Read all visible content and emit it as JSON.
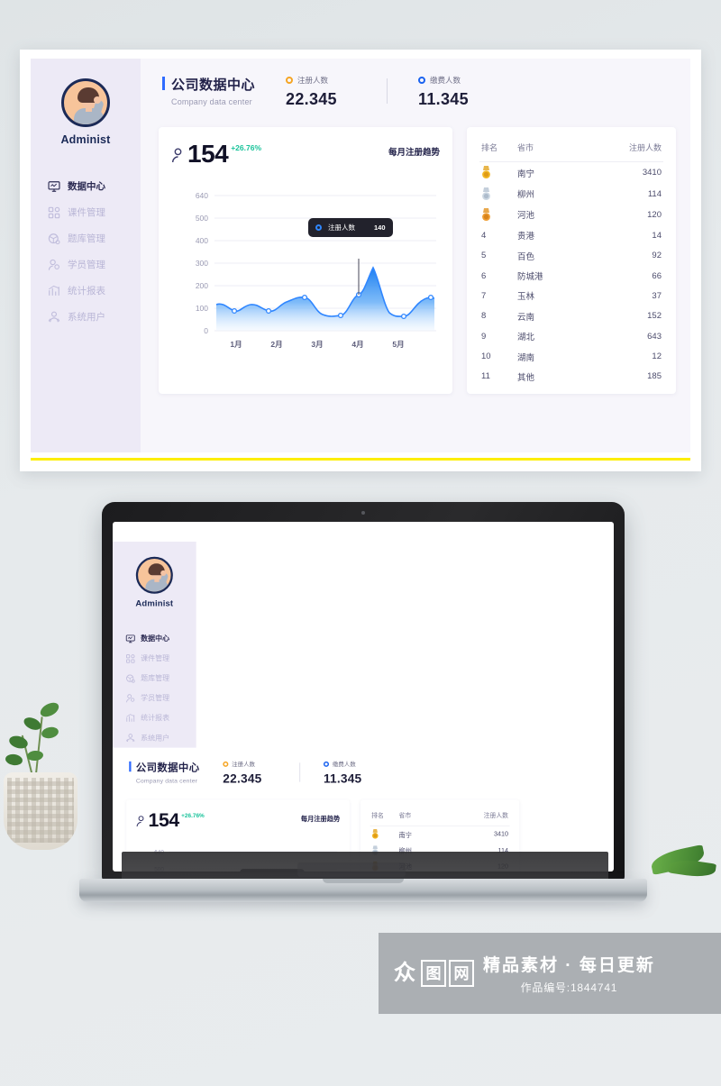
{
  "scene": {
    "background_color": "#e4e8ea",
    "laptop_label": "laptop-mockup"
  },
  "dashboard": {
    "sidebar": {
      "avatar_name": "Administ",
      "items": [
        {
          "label": "数据中心",
          "icon": "monitor-icon",
          "active": true
        },
        {
          "label": "课件管理",
          "icon": "grid-icon",
          "active": false
        },
        {
          "label": "题库管理",
          "icon": "box-icon",
          "active": false
        },
        {
          "label": "学员管理",
          "icon": "user-icon",
          "active": false
        },
        {
          "label": "统计报表",
          "icon": "chart-icon",
          "active": false
        },
        {
          "label": "系统用户",
          "icon": "users-icon",
          "active": false
        }
      ]
    },
    "header": {
      "title_cn": "公司数据中心",
      "title_en": "Company data center",
      "stats": [
        {
          "label": "注册人数",
          "value": "22.345",
          "color": "#f5a524"
        },
        {
          "label": "缴费人数",
          "value": "11.345",
          "color": "#1a63f0"
        }
      ]
    },
    "chart_card": {
      "icon": "person-icon",
      "value": "154",
      "change": "+26.76%",
      "change_color": "#18c39a",
      "subtitle": "每月注册趋势",
      "tooltip": {
        "series": "注册人数",
        "value": "140",
        "marker_color": "#2f86ff"
      }
    },
    "rank_card": {
      "columns": [
        "排名",
        "省市",
        "注册人数"
      ],
      "rows": [
        {
          "rank": "1",
          "medal": "gold-medal-icon",
          "city": "南宁",
          "count": "3410"
        },
        {
          "rank": "2",
          "medal": "silver-medal-icon",
          "city": "柳州",
          "count": "114"
        },
        {
          "rank": "3",
          "medal": "bronze-medal-icon",
          "city": "河池",
          "count": "120"
        },
        {
          "rank": "4",
          "medal": "",
          "city": "贵港",
          "count": "14"
        },
        {
          "rank": "5",
          "medal": "",
          "city": "百色",
          "count": "92"
        },
        {
          "rank": "6",
          "medal": "",
          "city": "防城港",
          "count": "66"
        },
        {
          "rank": "7",
          "medal": "",
          "city": "玉林",
          "count": "37"
        },
        {
          "rank": "8",
          "medal": "",
          "city": "云南",
          "count": "152"
        },
        {
          "rank": "9",
          "medal": "",
          "city": "湖北",
          "count": "643"
        },
        {
          "rank": "10",
          "medal": "",
          "city": "湖南",
          "count": "12"
        },
        {
          "rank": "11",
          "medal": "",
          "city": "其他",
          "count": "185"
        }
      ]
    }
  },
  "chart_data": {
    "type": "area",
    "title": "每月注册趋势",
    "xlabel": "",
    "ylabel": "",
    "categories": [
      "1月",
      "2月",
      "3月",
      "4月",
      "5月"
    ],
    "x": [
      0,
      0.5,
      1,
      1.5,
      2,
      2.5,
      3,
      3.5,
      4,
      4.5,
      5,
      5.5,
      6
    ],
    "values": [
      115,
      92,
      110,
      90,
      115,
      135,
      82,
      78,
      155,
      237,
      85,
      70,
      130
    ],
    "yticks": [
      0,
      100,
      200,
      300,
      400,
      500,
      640
    ],
    "ylim": [
      0,
      640
    ],
    "grid": true,
    "legend": false,
    "series_name": "注册人数",
    "line_color": "#2f86ff",
    "fill_gradient": [
      "#1b7ef0",
      "#e8f2ff"
    ],
    "annotation": {
      "label": "注册人数",
      "value": 140,
      "at_index": 8
    }
  },
  "watermark": {
    "logo_chars": [
      "众",
      "图",
      "网"
    ],
    "tagline": "精品素材 · 每日更新",
    "work_id": "作品编号:1844741"
  }
}
